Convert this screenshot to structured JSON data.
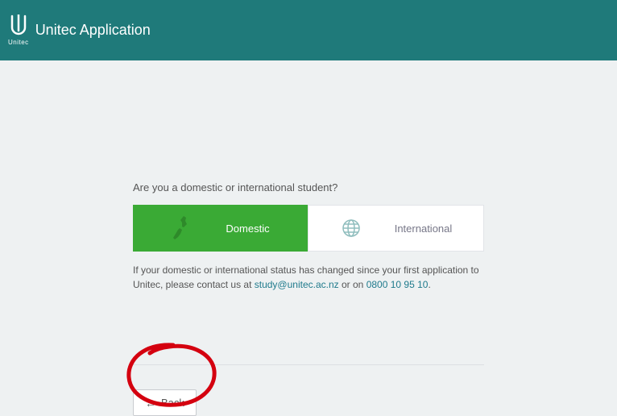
{
  "header": {
    "logo_text": "Unitec",
    "title": "Unitec Application"
  },
  "main": {
    "question": "Are you a domestic or international student?",
    "options": {
      "domestic": "Domestic",
      "international": "International"
    },
    "help": {
      "line1_prefix": "If your domestic or international status has changed since your first application to Unitec, please contact us at ",
      "email": "study@unitec.ac.nz",
      "mid": " or on ",
      "phone": "0800 10 95 10",
      "suffix": "."
    }
  },
  "footer": {
    "back_label": "Back"
  }
}
